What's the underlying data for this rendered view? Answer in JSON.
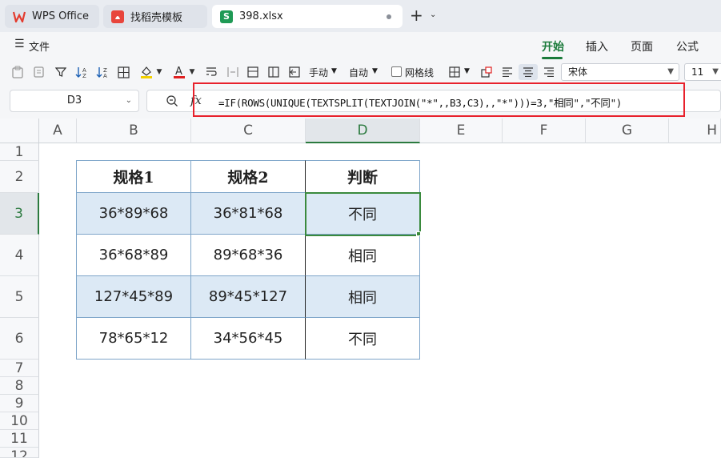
{
  "tabs": [
    {
      "label": "WPS Office",
      "icon": "wps-logo-icon",
      "color": "#e33b2e"
    },
    {
      "label": "找稻壳模板",
      "icon": "docer-logo-icon",
      "color": "#e8453c"
    },
    {
      "label": "398.xlsx",
      "icon": "spreadsheet-file-icon",
      "color": "#1f9a55",
      "icon_text": "S"
    }
  ],
  "new_tab_label": "+",
  "menu": {
    "file_label": "文件",
    "ribbon_tabs": [
      "开始",
      "插入",
      "页面",
      "公式"
    ],
    "selected_tab": "开始"
  },
  "toolbar": {
    "row_height_label": "手动",
    "col_width_label": "自动",
    "gridlines_label": "网格线",
    "font_name": "宋体",
    "font_size": "11"
  },
  "formula_bar": {
    "cell_ref": "D3",
    "fx_label": "fx",
    "formula": "=IF(ROWS(UNIQUE(TEXTSPLIT(TEXTJOIN(\"*\",,B3,C3),,\"*\")))=3,\"相同\",\"不同\")"
  },
  "sheet": {
    "columns": [
      "A",
      "B",
      "C",
      "D",
      "E",
      "F",
      "G",
      "H"
    ],
    "selected_column": "D",
    "rows": [
      "1",
      "2",
      "3",
      "4",
      "5",
      "6",
      "7",
      "8",
      "9",
      "10",
      "11",
      "12"
    ],
    "selected_row": "3",
    "table_headers": [
      "规格1",
      "规格2",
      "判断"
    ],
    "table_rows": [
      [
        "36*89*68",
        "36*81*68",
        "不同"
      ],
      [
        "36*68*89",
        "89*68*36",
        "相同"
      ],
      [
        "127*45*89",
        "89*45*127",
        "相同"
      ],
      [
        "78*65*12",
        "34*56*45",
        "不同"
      ]
    ]
  },
  "colors": {
    "accent": "#1a7a3a",
    "highlight_border": "#e8212c",
    "band_fill": "#dce9f5",
    "table_border": "#7ea5c9"
  }
}
